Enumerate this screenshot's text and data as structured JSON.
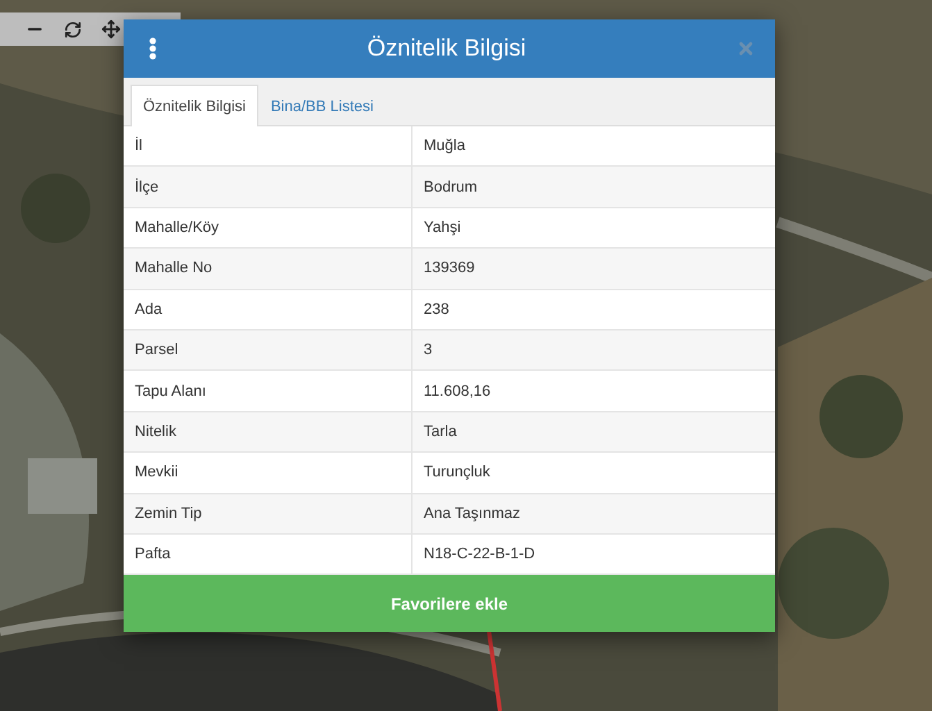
{
  "dialog": {
    "title": "Öznitelik Bilgisi",
    "tabs": [
      {
        "label": "Öznitelik Bilgisi",
        "selected": true
      },
      {
        "label": "Bina/BB Listesi",
        "selected": false
      }
    ],
    "rows": [
      {
        "label": "İl",
        "value": "Muğla"
      },
      {
        "label": "İlçe",
        "value": "Bodrum"
      },
      {
        "label": "Mahalle/Köy",
        "value": "Yahşi"
      },
      {
        "label": "Mahalle No",
        "value": "139369"
      },
      {
        "label": "Ada",
        "value": "238"
      },
      {
        "label": "Parsel",
        "value": "3"
      },
      {
        "label": "Tapu Alanı",
        "value": "11.608,16"
      },
      {
        "label": "Nitelik",
        "value": "Tarla"
      },
      {
        "label": "Mevkii",
        "value": "Turunçluk"
      },
      {
        "label": "Zemin Tip",
        "value": "Ana Taşınmaz"
      },
      {
        "label": "Pafta",
        "value": "N18-C-22-B-1-D"
      }
    ],
    "button": "Favorilere ekle"
  }
}
